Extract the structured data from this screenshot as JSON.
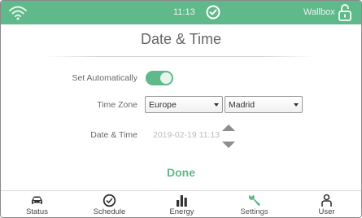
{
  "colors": {
    "accent": "#5fb98a",
    "muted_text": "#6a6a6a",
    "disabled_text": "#bdbdbd"
  },
  "status_bar": {
    "time": "11:13",
    "device_name": "Wallbox",
    "icons": [
      "wifi-icon",
      "check-circle-icon",
      "lock-icon"
    ]
  },
  "page": {
    "title": "Date & Time"
  },
  "settings": {
    "set_automatically": {
      "label": "Set Automatically",
      "enabled": true
    },
    "time_zone": {
      "label": "Time Zone",
      "region": "Europe",
      "city": "Madrid"
    },
    "date_time": {
      "label": "Date & Time",
      "value": "2019-02-19 11:13"
    }
  },
  "done_label": "Done",
  "nav": [
    {
      "label": "Status",
      "icon": "car-icon",
      "active": false
    },
    {
      "label": "Schedule",
      "icon": "clock-icon",
      "active": false
    },
    {
      "label": "Energy",
      "icon": "bar-chart-icon",
      "active": false
    },
    {
      "label": "Settings",
      "icon": "wrench-icon",
      "active": true
    },
    {
      "label": "User",
      "icon": "user-icon",
      "active": false
    }
  ]
}
